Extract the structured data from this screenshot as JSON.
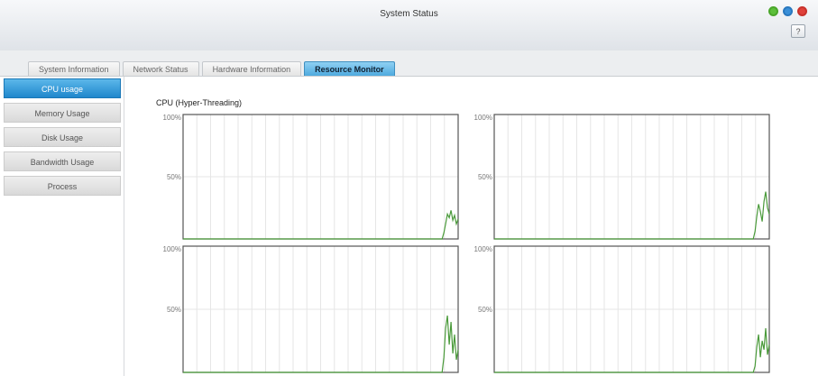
{
  "window": {
    "title": "System Status",
    "controls": [
      {
        "name": "minimize",
        "color": "#5cbf3a"
      },
      {
        "name": "maximize",
        "color": "#3a8fd8"
      },
      {
        "name": "close",
        "color": "#e0413a"
      }
    ],
    "help_label": "?"
  },
  "tabs": [
    {
      "label": "System Information",
      "active": false
    },
    {
      "label": "Network Status",
      "active": false
    },
    {
      "label": "Hardware Information",
      "active": false
    },
    {
      "label": "Resource Monitor",
      "active": true
    }
  ],
  "sidebar": {
    "items": [
      {
        "label": "CPU usage",
        "active": true
      },
      {
        "label": "Memory Usage",
        "active": false
      },
      {
        "label": "Disk Usage",
        "active": false
      },
      {
        "label": "Bandwidth Usage",
        "active": false
      },
      {
        "label": "Process",
        "active": false
      }
    ]
  },
  "main": {
    "chart_title": "CPU (Hyper-Threading)"
  },
  "chart_data": [
    {
      "type": "line",
      "ylim": [
        0,
        100
      ],
      "yticks": [
        "100%",
        "50%"
      ],
      "grid": true,
      "color": "#4a9a3a",
      "series": [
        {
          "values": [
            0,
            0,
            0,
            0,
            0,
            0,
            0,
            0,
            0,
            0,
            0,
            0,
            0,
            0,
            0,
            0,
            0,
            0,
            0,
            0,
            0,
            0,
            0,
            0,
            0,
            0,
            0,
            0,
            0,
            0,
            0,
            0,
            0,
            0,
            0,
            0,
            0,
            0,
            0,
            0,
            0,
            0,
            0,
            0,
            0,
            0,
            0,
            0,
            0,
            0,
            0,
            0,
            0,
            0,
            0,
            0,
            0,
            0,
            0,
            0,
            0,
            0,
            0,
            0,
            0,
            0,
            0,
            0,
            0,
            0,
            0,
            0,
            0,
            0,
            0,
            0,
            0,
            0,
            0,
            0,
            0,
            0,
            0,
            0,
            0,
            0,
            0,
            0,
            0,
            0,
            0,
            0,
            0,
            0,
            0,
            0,
            0,
            0,
            0,
            0,
            0,
            0,
            0,
            0,
            0,
            0,
            0,
            0,
            0,
            0,
            0,
            0,
            0,
            0,
            0,
            0,
            0,
            0,
            0,
            0,
            0,
            0,
            0,
            0,
            0,
            0,
            0,
            0,
            0,
            0,
            0,
            0,
            0,
            0,
            0,
            0,
            0,
            0,
            0,
            0,
            0,
            0,
            0,
            0,
            0,
            0,
            5,
            12,
            20,
            17,
            23,
            15,
            19,
            12,
            16
          ]
        }
      ]
    },
    {
      "type": "line",
      "ylim": [
        0,
        100
      ],
      "yticks": [
        "100%",
        "50%"
      ],
      "grid": true,
      "color": "#4a9a3a",
      "series": [
        {
          "values": [
            0,
            0,
            0,
            0,
            0,
            0,
            0,
            0,
            0,
            0,
            0,
            0,
            0,
            0,
            0,
            0,
            0,
            0,
            0,
            0,
            0,
            0,
            0,
            0,
            0,
            0,
            0,
            0,
            0,
            0,
            0,
            0,
            0,
            0,
            0,
            0,
            0,
            0,
            0,
            0,
            0,
            0,
            0,
            0,
            0,
            0,
            0,
            0,
            0,
            0,
            0,
            0,
            0,
            0,
            0,
            0,
            0,
            0,
            0,
            0,
            0,
            0,
            0,
            0,
            0,
            0,
            0,
            0,
            0,
            0,
            0,
            0,
            0,
            0,
            0,
            0,
            0,
            0,
            0,
            0,
            0,
            0,
            0,
            0,
            0,
            0,
            0,
            0,
            0,
            0,
            0,
            0,
            0,
            0,
            0,
            0,
            0,
            0,
            0,
            0,
            0,
            0,
            0,
            0,
            0,
            0,
            0,
            0,
            0,
            0,
            0,
            0,
            0,
            0,
            0,
            0,
            0,
            0,
            0,
            0,
            0,
            0,
            0,
            0,
            0,
            0,
            0,
            0,
            0,
            0,
            0,
            0,
            0,
            0,
            0,
            0,
            0,
            0,
            0,
            0,
            0,
            0,
            0,
            0,
            0,
            0,
            6,
            18,
            28,
            22,
            14,
            30,
            38,
            25,
            20
          ]
        }
      ]
    },
    {
      "type": "line",
      "ylim": [
        0,
        100
      ],
      "yticks": [
        "100%",
        "50%"
      ],
      "grid": true,
      "color": "#4a9a3a",
      "series": [
        {
          "values": [
            0,
            0,
            0,
            0,
            0,
            0,
            0,
            0,
            0,
            0,
            0,
            0,
            0,
            0,
            0,
            0,
            0,
            0,
            0,
            0,
            0,
            0,
            0,
            0,
            0,
            0,
            0,
            0,
            0,
            0,
            0,
            0,
            0,
            0,
            0,
            0,
            0,
            0,
            0,
            0,
            0,
            0,
            0,
            0,
            0,
            0,
            0,
            0,
            0,
            0,
            0,
            0,
            0,
            0,
            0,
            0,
            0,
            0,
            0,
            0,
            0,
            0,
            0,
            0,
            0,
            0,
            0,
            0,
            0,
            0,
            0,
            0,
            0,
            0,
            0,
            0,
            0,
            0,
            0,
            0,
            0,
            0,
            0,
            0,
            0,
            0,
            0,
            0,
            0,
            0,
            0,
            0,
            0,
            0,
            0,
            0,
            0,
            0,
            0,
            0,
            0,
            0,
            0,
            0,
            0,
            0,
            0,
            0,
            0,
            0,
            0,
            0,
            0,
            0,
            0,
            0,
            0,
            0,
            0,
            0,
            0,
            0,
            0,
            0,
            0,
            0,
            0,
            0,
            0,
            0,
            0,
            0,
            0,
            0,
            0,
            0,
            0,
            0,
            0,
            0,
            0,
            0,
            0,
            0,
            0,
            0,
            12,
            35,
            45,
            22,
            40,
            15,
            30,
            10,
            18
          ]
        }
      ]
    },
    {
      "type": "line",
      "ylim": [
        0,
        100
      ],
      "yticks": [
        "100%",
        "50%"
      ],
      "grid": true,
      "color": "#4a9a3a",
      "series": [
        {
          "values": [
            0,
            0,
            0,
            0,
            0,
            0,
            0,
            0,
            0,
            0,
            0,
            0,
            0,
            0,
            0,
            0,
            0,
            0,
            0,
            0,
            0,
            0,
            0,
            0,
            0,
            0,
            0,
            0,
            0,
            0,
            0,
            0,
            0,
            0,
            0,
            0,
            0,
            0,
            0,
            0,
            0,
            0,
            0,
            0,
            0,
            0,
            0,
            0,
            0,
            0,
            0,
            0,
            0,
            0,
            0,
            0,
            0,
            0,
            0,
            0,
            0,
            0,
            0,
            0,
            0,
            0,
            0,
            0,
            0,
            0,
            0,
            0,
            0,
            0,
            0,
            0,
            0,
            0,
            0,
            0,
            0,
            0,
            0,
            0,
            0,
            0,
            0,
            0,
            0,
            0,
            0,
            0,
            0,
            0,
            0,
            0,
            0,
            0,
            0,
            0,
            0,
            0,
            0,
            0,
            0,
            0,
            0,
            0,
            0,
            0,
            0,
            0,
            0,
            0,
            0,
            0,
            0,
            0,
            0,
            0,
            0,
            0,
            0,
            0,
            0,
            0,
            0,
            0,
            0,
            0,
            0,
            0,
            0,
            0,
            0,
            0,
            0,
            0,
            0,
            0,
            0,
            0,
            0,
            0,
            0,
            0,
            5,
            20,
            30,
            12,
            25,
            18,
            35,
            14,
            22
          ]
        }
      ]
    }
  ]
}
